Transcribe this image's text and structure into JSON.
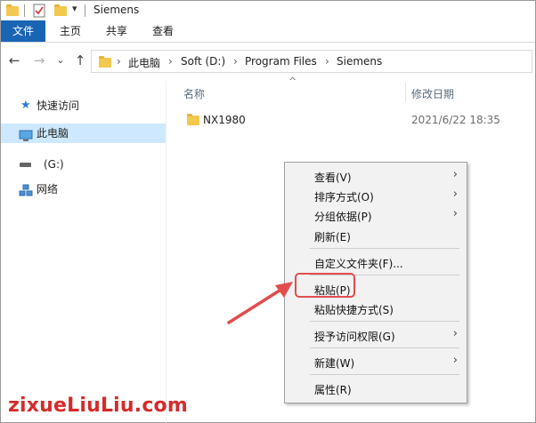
{
  "window": {
    "title": "Siemens"
  },
  "ribbon": {
    "tabs": [
      "文件",
      "主页",
      "共享",
      "查看"
    ]
  },
  "nav": {
    "back": "←",
    "forward": "→",
    "recent": "⌄",
    "up": "↑",
    "breadcrumb": [
      "此电脑",
      "Soft (D:)",
      "Program Files",
      "Siemens"
    ],
    "sort_indicator": "^"
  },
  "sidebar": {
    "items": [
      {
        "label": "快速访问",
        "icon": "pin-icon"
      },
      {
        "label": "此电脑",
        "icon": "computer-icon",
        "selected": true
      },
      {
        "label": "(G:)",
        "icon": "drive-icon"
      },
      {
        "label": "网络",
        "icon": "network-icon"
      }
    ]
  },
  "content": {
    "columns": [
      "名称",
      "修改日期"
    ],
    "rows": [
      {
        "name": "NX1980",
        "date": "2021/6/22 18:35"
      }
    ]
  },
  "context_menu": {
    "items": [
      {
        "label": "查看(V)",
        "submenu": true
      },
      {
        "label": "排序方式(O)",
        "submenu": true
      },
      {
        "label": "分组依据(P)",
        "submenu": true
      },
      {
        "label": "刷新(E)",
        "submenu": false
      },
      {
        "label": "自定义文件夹(F)...",
        "submenu": false
      },
      {
        "label": "粘贴(P)",
        "submenu": false,
        "highlighted": true
      },
      {
        "label": "粘贴快捷方式(S)",
        "submenu": false
      },
      {
        "label": "授予访问权限(G)",
        "submenu": true
      },
      {
        "label": "新建(W)",
        "submenu": true
      },
      {
        "label": "属性(R)",
        "submenu": false
      }
    ],
    "submenu_glyph": "›"
  },
  "watermark": "zixueLiuLiu.com",
  "colors": {
    "accent": "#1a64b4",
    "selection": "#cde8ff",
    "annotation": "#e24d4d",
    "folder": "#f3c84f"
  }
}
